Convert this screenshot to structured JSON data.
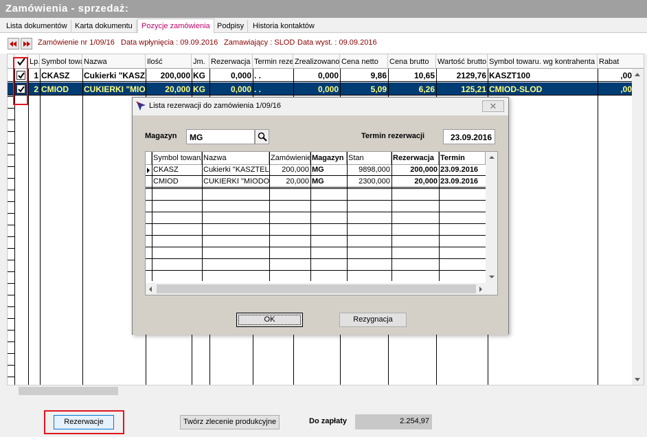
{
  "window": {
    "title": "Zamówienia - sprzedaż:"
  },
  "tabs": [
    {
      "label": "Lista dokumentów"
    },
    {
      "label": "Karta dokumentu"
    },
    {
      "label": "Pozycje zamówienia"
    },
    {
      "label": "Podpisy"
    },
    {
      "label": "Historia kontaktów"
    }
  ],
  "info": {
    "order": "Zamówienie nr 1/09/16",
    "received": "Data wpłynięcia : 09.09.2016",
    "ordering": "Zamawiający : SLOD",
    "issued": "Data wyst. : 09.09.2016"
  },
  "grid": {
    "headers": [
      "Lp.",
      "Symbol towa",
      "Nazwa",
      "Ilość",
      "Jm.",
      "Rezerwacja",
      "Termin rezer",
      "Zrealizowano",
      "Cena netto",
      "Cena brutto",
      "Wartość brutto",
      "Symbol towaru. wg kontrahenta",
      "Rabat"
    ],
    "rows": [
      {
        "checked": true,
        "lp": "1",
        "symbol": "CKASZ",
        "name": "Cukierki \"KASZ",
        "qty": "200,000",
        "unit": "KG",
        "reservation": "0,000",
        "term": ". .",
        "realized": "0,000",
        "net": "9,86",
        "gross": "10,65",
        "value": "2129,76",
        "ksymbol": "KASZT100",
        "discount": ",00"
      },
      {
        "checked": true,
        "lp": "2",
        "symbol": "CMIOD",
        "name": "CUKIERKI \"MIO",
        "qty": "20,000",
        "unit": "KG",
        "reservation": "0,000",
        "term": ". .",
        "realized": "0,000",
        "net": "5,09",
        "gross": "6,26",
        "value": "125,21",
        "ksymbol": "CMIOD-SLOD",
        "discount": ",00"
      }
    ]
  },
  "dialog": {
    "title": "Lista rezerwacji do zamówienia 1/09/16",
    "close": "✕",
    "magazyn_label": "Magazyn",
    "magazyn_value": "MG",
    "term_label": "Termin rezerwacji",
    "term_value": "23.09.2016",
    "headers": [
      "Symbol towaru",
      "Nazwa",
      "Zamówienie",
      "Magazyn",
      "Stan",
      "Rezerwacja",
      "Termin"
    ],
    "rows": [
      {
        "symbol": "CKASZ",
        "name": "Cukierki \"KASZTEL",
        "order": "200,000",
        "mag": "MG",
        "stock": "9898,000",
        "res": "200,000",
        "term": "23.09.2016"
      },
      {
        "symbol": "CMIOD",
        "name": "CUKIERKI \"MIODO",
        "order": "20,000",
        "mag": "MG",
        "stock": "2300,000",
        "res": "20,000",
        "term": "23.09.2016"
      }
    ],
    "ok": "OK",
    "cancel": "Rezygnacja"
  },
  "footer": {
    "reserve": "Rezerwacje",
    "production": "Twórz zlecenie produkcyjne",
    "total_label": "Do zapłaty",
    "total_value": "2.254,97"
  }
}
